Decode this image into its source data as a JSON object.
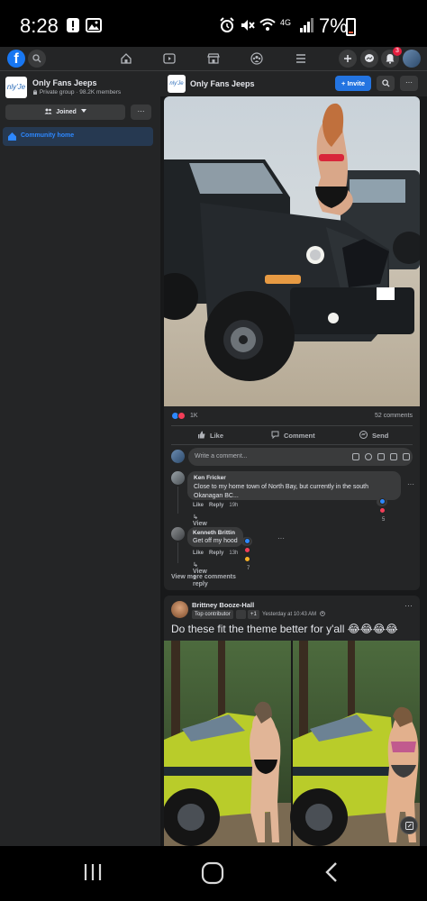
{
  "status_bar": {
    "time": "8:28",
    "network": "4G",
    "battery": "7%"
  },
  "nav": {
    "logo": "f",
    "notification_count": "3"
  },
  "sidebar": {
    "group_logo_text": "nly'Je",
    "group_name": "Only Fans Jeeps",
    "privacy": "Private group",
    "members": "98.2K members",
    "joined_label": "Joined",
    "more_label": "···",
    "community_home_label": "Community home"
  },
  "group_header": {
    "title": "Only Fans Jeeps",
    "invite_label": "Invite",
    "more_label": "···"
  },
  "post1": {
    "reaction_count": "1K",
    "comments_count": "52 comments",
    "like_label": "Like",
    "comment_label": "Comment",
    "send_label": "Send",
    "write_placeholder": "Write a comment...",
    "comments": [
      {
        "name": "Ken Fricker",
        "text_line1": "Close to my home town of North Bay, but currently in the south",
        "text_line2": "Okanagan BC...",
        "like": "Like",
        "reply": "Reply",
        "time": "19h",
        "reactions": "5",
        "view_replies": "View 1 reply"
      },
      {
        "name": "Kenneth Brittin",
        "text_line1": "Get off my hood",
        "like": "Like",
        "reply": "Reply",
        "time": "13h",
        "reactions": "7",
        "view_replies": "View 1 reply"
      }
    ],
    "view_more_comments": "View more comments"
  },
  "post2": {
    "author": "Brittney Booze-Hall",
    "badge": "Top contributor",
    "badge_extra": "+1",
    "time": "Yesterday at 10:43 AM",
    "text": "Do these fit the theme better for y'all 😂😂😂😂",
    "more_label": "···"
  },
  "colors": {
    "background": "#18191a",
    "surface": "#242526",
    "accent": "#2374e1",
    "text": "#e4e6eb",
    "secondary_text": "#b0b3b8"
  }
}
